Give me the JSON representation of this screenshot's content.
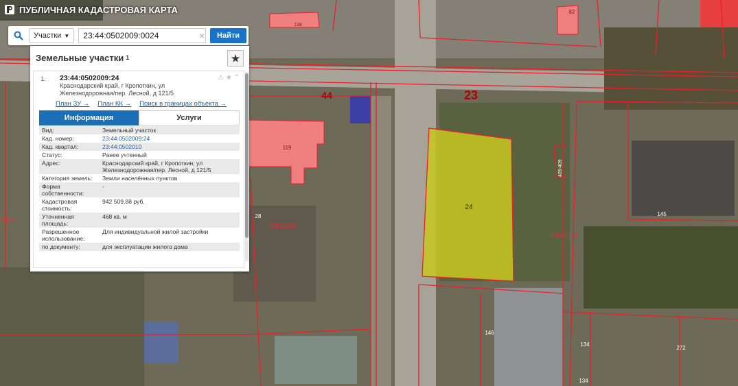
{
  "app": {
    "title": "ПУБЛИЧНАЯ КАДАСТРОВАЯ КАРТА"
  },
  "search": {
    "layer": "Участки",
    "value": "23:44:0502009:0024",
    "find_label": "Найти"
  },
  "panel": {
    "title": "Земельные участки",
    "count": "1",
    "result": {
      "num": "1.",
      "kad": "23:44:0502009:24",
      "address_line1": "Краснодарский край, г Кропоткин, ул",
      "address_line2": "Железнодорожная/пер. Лесной, д 121/5",
      "links": [
        "План ЗУ →",
        "План КК →",
        "Поиск в границах объекта →"
      ]
    },
    "tabs": [
      "Информация",
      "Услуги"
    ],
    "rows": [
      {
        "k": "Вид:",
        "v": "Земельный участок"
      },
      {
        "k": "Кад. номер:",
        "v": "23:44:0502009:24",
        "link": true
      },
      {
        "k": "Кад. квартал:",
        "v": "23:44:0502010",
        "link": true
      },
      {
        "k": "Статус:",
        "v": "Ранее учтенный"
      },
      {
        "k": "Адрес:",
        "v": "Краснодарский край, г Кропоткин, ул Железнодорожная/пер. Лесной, д 121/5"
      },
      {
        "k": "Категория земель:",
        "v": "Земли населённых пунктов"
      },
      {
        "k": "Форма собственности:",
        "v": "-"
      },
      {
        "k": "Кадастровая стоимость:",
        "v": "942 509,88 руб."
      },
      {
        "k": "Уточненная площадь:",
        "v": "468 кв. м"
      },
      {
        "k": "Разрешенное использование:",
        "v": "Для индивидуальной жилой застройки"
      },
      {
        "k": "по документу:",
        "v": "для эксплуатации жилого дома"
      }
    ]
  },
  "map_labels": {
    "street_44": "44",
    "street_23": "23",
    "parcel_24": "24",
    "parcel_119": "119",
    "parcel_145": "145",
    "parcel_146": "146",
    "parcel_134a": "134",
    "parcel_134b": "134",
    "parcel_272": "272",
    "parcel_28": "28",
    "parcel_82": "82",
    "parcel_138": "138",
    "parcel_vert": "405-409",
    "block_0502008": "0502008",
    "block_0502010": "0502010",
    "block_left": "2008"
  },
  "colors": {
    "accent": "#1a6fb7",
    "selected_parcel": "#c8c820",
    "parcel_fill": "#f08080",
    "boundary": "#e8202a"
  }
}
